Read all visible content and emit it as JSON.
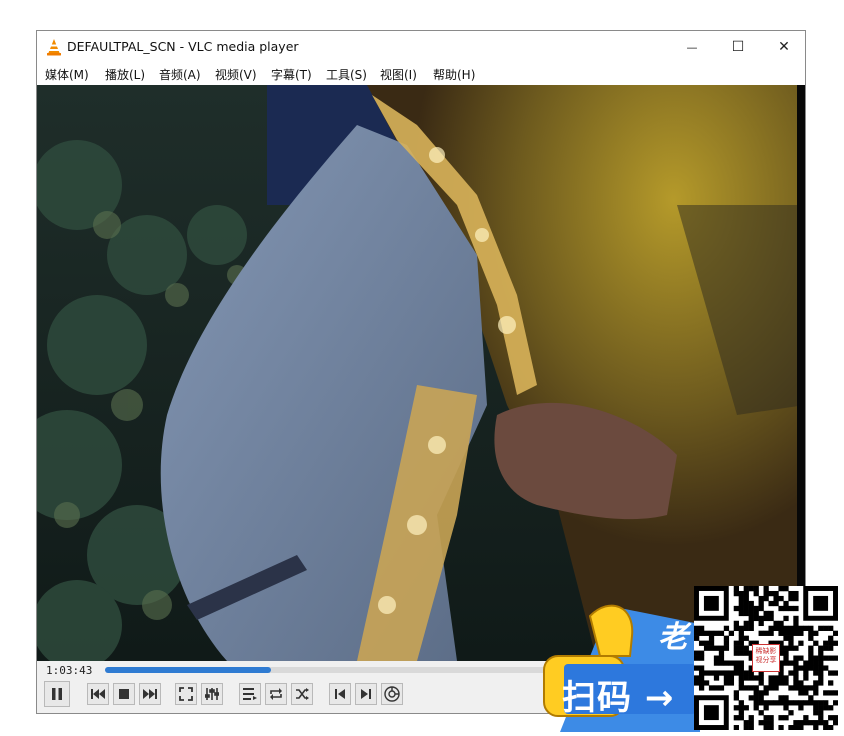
{
  "window": {
    "title": "DEFAULTPAL_SCN - VLC media player",
    "controls": {
      "minimize": "—",
      "maximize": "☐",
      "close": "✕"
    }
  },
  "menu": [
    {
      "label": "媒体(M)"
    },
    {
      "label": "播放(L)"
    },
    {
      "label": "音频(A)"
    },
    {
      "label": "视频(V)"
    },
    {
      "label": "字幕(T)"
    },
    {
      "label": "工具(S)"
    },
    {
      "label": "视图(I)"
    },
    {
      "label": "帮助(H)"
    }
  ],
  "player": {
    "elapsed": "1:03:43",
    "progress": 0.24,
    "accent": "#2f7bd2"
  },
  "controls": [
    "pause-icon",
    "previous-icon",
    "stop-icon",
    "next-icon",
    "fullscreen-icon",
    "equalizer-icon",
    "playlist-icon",
    "loop-icon",
    "shuffle-icon",
    "frame-back-icon",
    "frame-forward-icon",
    "snapshot-icon"
  ],
  "overlay": {
    "scan_text": "扫码 →",
    "badge_text": "老",
    "qr_text": "稀缺影视分享"
  }
}
